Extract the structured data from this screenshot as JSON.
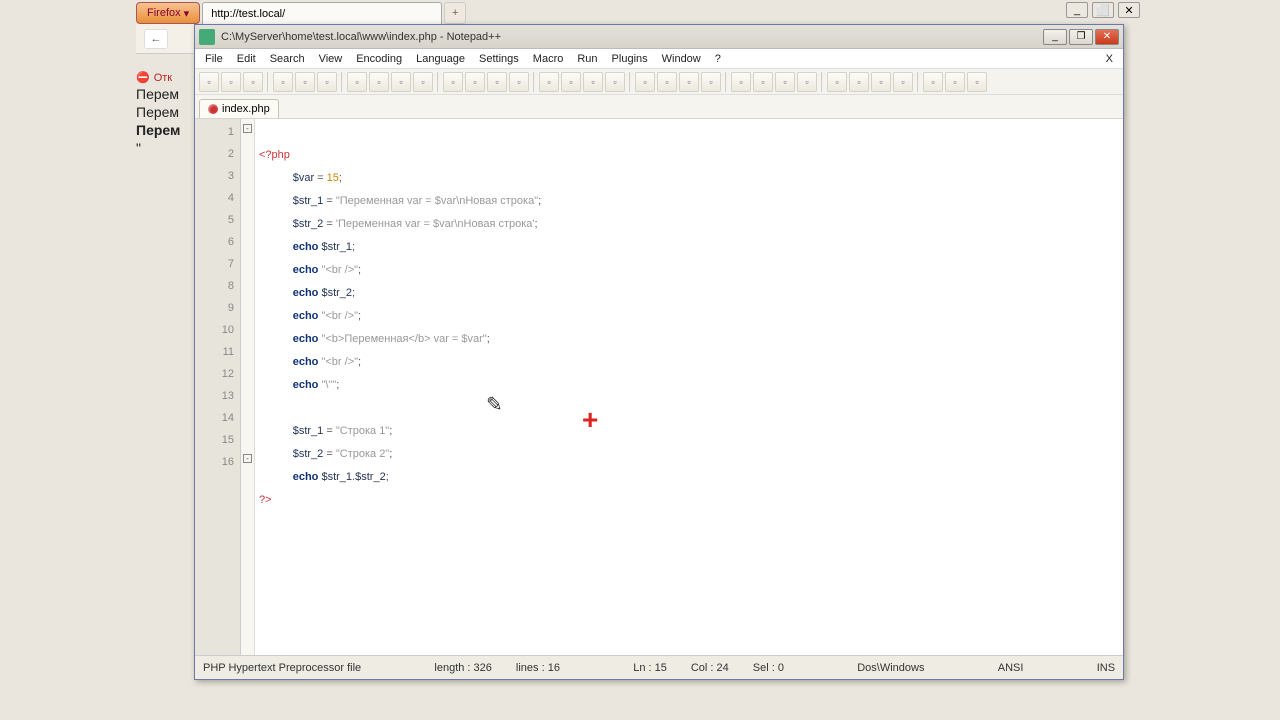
{
  "os_window": {
    "min": "_",
    "max": "⬜",
    "close": "✕"
  },
  "firefox": {
    "button_label": "Firefox",
    "tab_title": "http://test.local/",
    "add_tab": "+",
    "back": "←",
    "reload": "⟳",
    "err_icon": "⛔",
    "err_label": "Отк",
    "page_lines": [
      "Перем",
      "Перем",
      "Перем",
      "\""
    ],
    "bold_line_index": 2
  },
  "npp": {
    "title": "C:\\MyServer\\home\\test.local\\www\\index.php - Notepad++",
    "win": {
      "min": "_",
      "max": "❐",
      "close": "✕"
    },
    "menu": [
      "File",
      "Edit",
      "Search",
      "View",
      "Encoding",
      "Language",
      "Settings",
      "Macro",
      "Run",
      "Plugins",
      "Window",
      "?"
    ],
    "menu_close": "X",
    "toolbar_count": 33,
    "tab": {
      "filename": "index.php"
    },
    "gutter": [
      "1",
      "2",
      "3",
      "4",
      "5",
      "6",
      "7",
      "8",
      "9",
      "10",
      "11",
      "12",
      "13",
      "14",
      "15",
      "16"
    ],
    "code": {
      "l1_open": "<?php",
      "l2_v": "$var",
      "l2_eq": " = ",
      "l2_n": "15",
      "l2_sc": ";",
      "l3_v": "$str_1",
      "l3_eq": " = ",
      "l3_s": "\"Переменная var = $var\\nНовая строка\"",
      "l3_sc": ";",
      "l4_v": "$str_2",
      "l4_eq": " = ",
      "l4_s": "'Переменная var = $var\\nНовая строка'",
      "l4_sc": ";",
      "l5_k": "echo",
      "l5_sp": " ",
      "l5_v": "$str_1",
      "l5_sc": ";",
      "l6_k": "echo",
      "l6_sp": " ",
      "l6_s": "\"<br />\"",
      "l6_sc": ";",
      "l7_k": "echo",
      "l7_sp": " ",
      "l7_v": "$str_2",
      "l7_sc": ";",
      "l8_k": "echo",
      "l8_sp": " ",
      "l8_s": "\"<br />\"",
      "l8_sc": ";",
      "l9_k": "echo",
      "l9_sp": " ",
      "l9_s": "\"<b>Переменная</b> var = $var\"",
      "l9_sc": ";",
      "l10_k": "echo",
      "l10_sp": " ",
      "l10_s": "\"<br />\"",
      "l10_sc": ";",
      "l11_k": "echo",
      "l11_sp": " ",
      "l11_s": "\"\\\"\"",
      "l11_sc": ";",
      "l12": "",
      "l13_v": "$str_1",
      "l13_eq": " = ",
      "l13_s": "\"Строка 1\"",
      "l13_sc": ";",
      "l14_v": "$str_2",
      "l14_eq": " = ",
      "l14_s": "\"Строка 2\"",
      "l14_sc": ";",
      "l15_k": "echo",
      "l15_sp": " ",
      "l15_v1": "$str_1",
      "l15_dot": ".",
      "l15_v2": "$str_2",
      "l15_sc": ";",
      "l16_close": "?>"
    },
    "status": {
      "type": "PHP Hypertext Preprocessor file",
      "length": "length : 326",
      "lines": "lines : 16",
      "ln": "Ln : 15",
      "col": "Col : 24",
      "sel": "Sel : 0",
      "eol": "Dos\\Windows",
      "enc": "ANSI",
      "ovr": "INS"
    }
  }
}
